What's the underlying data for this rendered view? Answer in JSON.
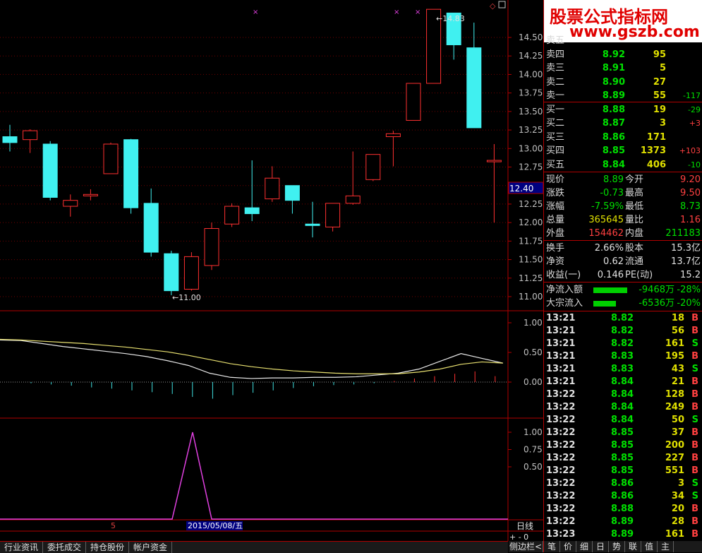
{
  "chart_data": {
    "type": "candlestick",
    "price_ticks": [
      "14.50",
      "14.25",
      "14.00",
      "13.75",
      "13.50",
      "13.25",
      "13.00",
      "12.75",
      "12.50",
      "12.25",
      "12.00",
      "11.75",
      "11.50",
      "11.25",
      "11.00"
    ],
    "ohlc": [
      [
        13.16,
        13.32,
        12.96,
        13.08
      ],
      [
        13.12,
        13.26,
        12.94,
        13.24
      ],
      [
        13.06,
        13.1,
        12.3,
        12.34
      ],
      [
        12.22,
        12.38,
        12.08,
        12.3
      ],
      [
        12.36,
        12.45,
        12.3,
        12.38
      ],
      [
        12.66,
        13.08,
        12.66,
        13.06
      ],
      [
        13.12,
        13.13,
        12.12,
        12.2
      ],
      [
        12.26,
        12.46,
        11.54,
        11.6
      ],
      [
        11.58,
        11.62,
        11.02,
        11.08
      ],
      [
        11.1,
        11.6,
        11.08,
        11.54
      ],
      [
        11.42,
        12.0,
        11.36,
        11.92
      ],
      [
        11.98,
        12.26,
        11.94,
        12.22
      ],
      [
        12.2,
        12.84,
        12.02,
        12.12
      ],
      [
        12.32,
        12.76,
        12.28,
        12.6
      ],
      [
        12.5,
        12.5,
        12.12,
        12.3
      ],
      [
        11.98,
        12.28,
        11.8,
        11.96
      ],
      [
        11.94,
        12.2,
        11.88,
        12.26
      ],
      [
        12.26,
        12.96,
        12.24,
        12.36
      ],
      [
        12.58,
        12.92,
        12.56,
        12.92
      ],
      [
        13.16,
        13.24,
        12.76,
        13.2
      ],
      [
        13.38,
        13.88,
        13.38,
        13.88
      ],
      [
        13.88,
        14.88,
        13.88,
        14.88
      ],
      [
        14.83,
        14.83,
        14.2,
        14.4
      ],
      [
        14.36,
        14.7,
        13.76,
        13.28
      ],
      [
        12.84,
        13.06,
        12.0,
        12.84
      ]
    ],
    "high_marker": "14.83",
    "low_marker": "11.00",
    "current_price_tag": "12.40",
    "macd_ticks": [
      "1.00",
      "0.50",
      "0.00"
    ],
    "signal_ticks": [
      "1.00",
      "0.75",
      "0.50"
    ],
    "date_label": "2015/05/08/五",
    "left_marker": "5",
    "period_label": "日线"
  },
  "brand": {
    "cn": "股票公式指标网",
    "url": "www.gszb.com"
  },
  "orderbook": [
    {
      "label": "卖五",
      "price": "",
      "vol": "",
      "chg": ""
    },
    {
      "label": "卖四",
      "price": "8.92",
      "vol": "95",
      "chg": ""
    },
    {
      "label": "卖三",
      "price": "8.91",
      "vol": "5",
      "chg": ""
    },
    {
      "label": "卖二",
      "price": "8.90",
      "vol": "27",
      "chg": ""
    },
    {
      "label": "卖一",
      "price": "8.89",
      "vol": "55",
      "chg": "-117"
    },
    {
      "label": "买一",
      "price": "8.88",
      "vol": "19",
      "chg": "-29"
    },
    {
      "label": "买二",
      "price": "8.87",
      "vol": "3",
      "chg": "+3"
    },
    {
      "label": "买三",
      "price": "8.86",
      "vol": "171",
      "chg": ""
    },
    {
      "label": "买四",
      "price": "8.85",
      "vol": "1373",
      "chg": "+103"
    },
    {
      "label": "买五",
      "price": "8.84",
      "vol": "406",
      "chg": "-10"
    }
  ],
  "quote": [
    {
      "l1": "现价",
      "v1": "8.89",
      "l2": "今开",
      "v2": "9.20"
    },
    {
      "l1": "涨跌",
      "v1": "-0.73",
      "l2": "最高",
      "v2": "9.50"
    },
    {
      "l1": "涨幅",
      "v1": "-7.59%",
      "l2": "最低",
      "v2": "8.73"
    },
    {
      "l1": "总量",
      "v1": "365645",
      "l2": "量比",
      "v2": "1.16"
    },
    {
      "l1": "外盘",
      "v1": "154462",
      "l2": "内盘",
      "v2": "211183"
    }
  ],
  "fund": [
    {
      "l1": "换手",
      "v1": "2.66%",
      "l2": "股本",
      "v2": "15.3亿"
    },
    {
      "l1": "净资",
      "v1": "0.62",
      "l2": "流通",
      "v2": "13.7亿"
    },
    {
      "l1": "收益(一)",
      "v1": "0.146",
      "l2": "PE(动)",
      "v2": "15.2"
    }
  ],
  "flow": [
    {
      "label": "净流入额",
      "value": "-9468万",
      "pct": "-28%"
    },
    {
      "label": "大宗流入",
      "value": "-6536万",
      "pct": "-20%"
    }
  ],
  "ticks": [
    {
      "t": "13:21",
      "p": "8.82",
      "v": "18",
      "bs": "B"
    },
    {
      "t": "13:21",
      "p": "8.82",
      "v": "56",
      "bs": "B"
    },
    {
      "t": "13:21",
      "p": "8.82",
      "v": "161",
      "bs": "S"
    },
    {
      "t": "13:21",
      "p": "8.83",
      "v": "195",
      "bs": "B"
    },
    {
      "t": "13:21",
      "p": "8.83",
      "v": "43",
      "bs": "S"
    },
    {
      "t": "13:21",
      "p": "8.84",
      "v": "21",
      "bs": "B"
    },
    {
      "t": "13:22",
      "p": "8.84",
      "v": "128",
      "bs": "B"
    },
    {
      "t": "13:22",
      "p": "8.84",
      "v": "249",
      "bs": "B"
    },
    {
      "t": "13:22",
      "p": "8.84",
      "v": "50",
      "bs": "S"
    },
    {
      "t": "13:22",
      "p": "8.85",
      "v": "37",
      "bs": "B"
    },
    {
      "t": "13:22",
      "p": "8.85",
      "v": "200",
      "bs": "B"
    },
    {
      "t": "13:22",
      "p": "8.85",
      "v": "227",
      "bs": "B"
    },
    {
      "t": "13:22",
      "p": "8.85",
      "v": "551",
      "bs": "B"
    },
    {
      "t": "13:22",
      "p": "8.86",
      "v": "3",
      "bs": "S"
    },
    {
      "t": "13:22",
      "p": "8.86",
      "v": "34",
      "bs": "S"
    },
    {
      "t": "13:22",
      "p": "8.88",
      "v": "20",
      "bs": "B"
    },
    {
      "t": "13:22",
      "p": "8.89",
      "v": "28",
      "bs": "B"
    },
    {
      "t": "13:23",
      "p": "8.89",
      "v": "161",
      "bs": "B"
    }
  ],
  "bottom_tabs": [
    "行业资讯",
    "委托成交",
    "持仓股份",
    "帐户资金"
  ],
  "side_tabs": [
    "笔",
    "价",
    "细",
    "日",
    "势",
    "联",
    "值",
    "主"
  ],
  "side_tab_label": "侧边栏<"
}
